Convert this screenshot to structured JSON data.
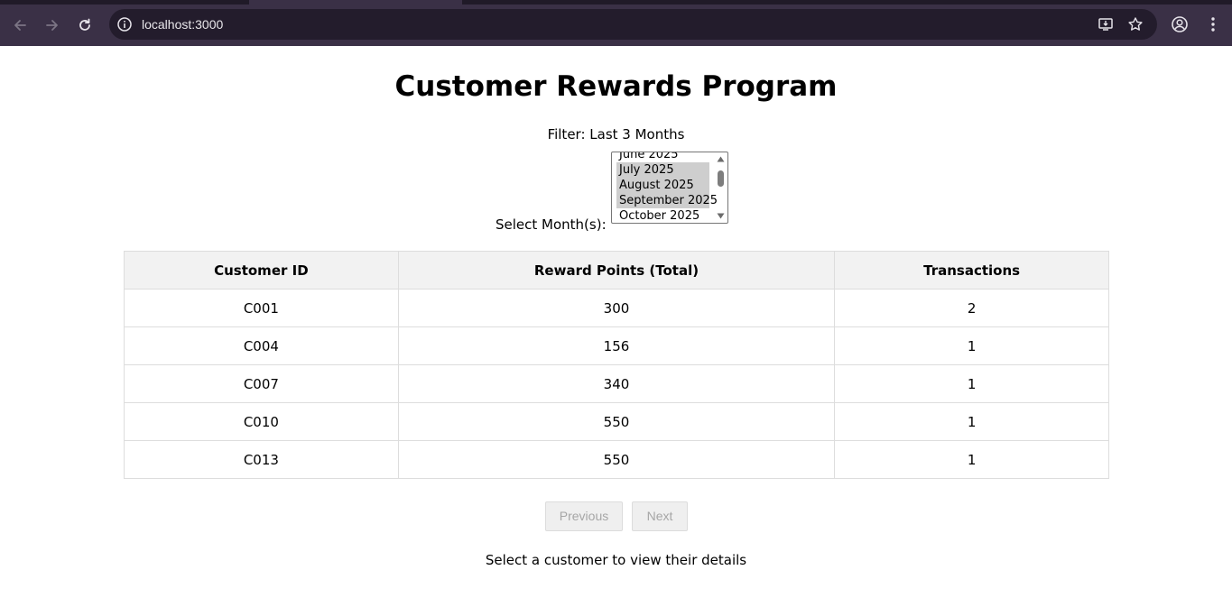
{
  "browser": {
    "url": "localhost:3000"
  },
  "page": {
    "title": "Customer Rewards Program",
    "filter_label": "Filter: Last 3 Months",
    "month_select_label": "Select Month(s):",
    "months": [
      {
        "label": "June 2025",
        "selected": false
      },
      {
        "label": "July 2025",
        "selected": true
      },
      {
        "label": "August 2025",
        "selected": true
      },
      {
        "label": "September 2025",
        "selected": true
      },
      {
        "label": "October 2025",
        "selected": false
      }
    ],
    "table": {
      "headers": [
        "Customer ID",
        "Reward Points (Total)",
        "Transactions"
      ],
      "rows": [
        {
          "id": "C001",
          "points": "300",
          "transactions": "2"
        },
        {
          "id": "C004",
          "points": "156",
          "transactions": "1"
        },
        {
          "id": "C007",
          "points": "340",
          "transactions": "1"
        },
        {
          "id": "C010",
          "points": "550",
          "transactions": "1"
        },
        {
          "id": "C013",
          "points": "550",
          "transactions": "1"
        }
      ]
    },
    "pagination": {
      "previous_label": "Previous",
      "next_label": "Next"
    },
    "hint": "Select a customer to view their details"
  },
  "colors": {
    "chrome_bg": "#3a3046",
    "omnibox_bg": "#231c2c",
    "header_bg": "#f2f2f2",
    "selected_option_bg": "#cecece"
  }
}
